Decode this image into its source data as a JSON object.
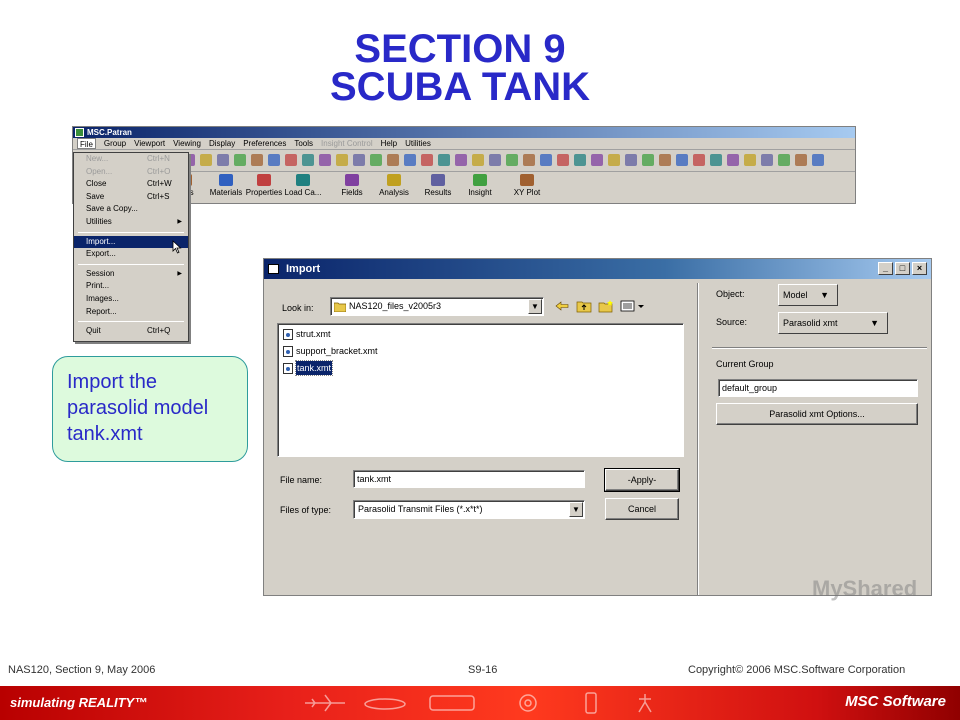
{
  "slide": {
    "title_line1": "SECTION 9",
    "title_line2": "SCUBA TANK",
    "callout": "Import the parasolid model tank.xmt",
    "footer_left": "NAS120, Section 9, May 2006",
    "footer_center": "S9-16",
    "footer_right": "Copyright© 2006 MSC.Software Corporation",
    "brand_left": "simulating REALITY™",
    "brand_right": "MSC Software",
    "watermark": "MyShared"
  },
  "patran": {
    "title": "MSC.Patran",
    "menu": [
      {
        "label": "File",
        "state": "active"
      },
      {
        "label": "Group",
        "state": "normal"
      },
      {
        "label": "Viewport",
        "state": "normal"
      },
      {
        "label": "Viewing",
        "state": "normal"
      },
      {
        "label": "Display",
        "state": "normal"
      },
      {
        "label": "Preferences",
        "state": "normal"
      },
      {
        "label": "Tools",
        "state": "normal"
      },
      {
        "label": "Insight Control",
        "state": "disabled"
      },
      {
        "label": "Help",
        "state": "normal"
      },
      {
        "label": "Utilities",
        "state": "normal"
      }
    ],
    "apps": [
      "/BCs",
      "Materials",
      "Properties",
      "Load Ca...",
      "Fields",
      "Analysis",
      "Results",
      "Insight",
      "XY Plot"
    ],
    "file_menu": [
      {
        "label": "New...",
        "shortcut": "Ctrl+N",
        "state": "disabled"
      },
      {
        "label": "Open...",
        "shortcut": "Ctrl+O",
        "state": "disabled"
      },
      {
        "label": "Close",
        "shortcut": "Ctrl+W",
        "state": "normal"
      },
      {
        "label": "Save",
        "shortcut": "Ctrl+S",
        "state": "normal"
      },
      {
        "label": "Save a Copy...",
        "shortcut": "",
        "state": "normal"
      },
      {
        "label": "Utilities",
        "shortcut": "",
        "state": "submenu"
      },
      {
        "sep": true
      },
      {
        "label": "Import...",
        "shortcut": "",
        "state": "selected"
      },
      {
        "label": "Export...",
        "shortcut": "",
        "state": "normal"
      },
      {
        "sep": true
      },
      {
        "label": "Session",
        "shortcut": "",
        "state": "submenu"
      },
      {
        "label": "Print...",
        "shortcut": "",
        "state": "normal"
      },
      {
        "label": "Images...",
        "shortcut": "",
        "state": "normal"
      },
      {
        "label": "Report...",
        "shortcut": "",
        "state": "normal"
      },
      {
        "sep": true
      },
      {
        "label": "Quit",
        "shortcut": "Ctrl+Q",
        "state": "normal"
      }
    ]
  },
  "import_dialog": {
    "title": "Import",
    "look_in_label": "Look in:",
    "look_in_value": "NAS120_files_v2005r3",
    "files": [
      {
        "name": "strut.xmt",
        "selected": false
      },
      {
        "name": "support_bracket.xmt",
        "selected": false
      },
      {
        "name": "tank.xmt",
        "selected": true
      }
    ],
    "file_name_label": "File name:",
    "file_name_value": "tank.xmt",
    "files_of_type_label": "Files of type:",
    "files_of_type_value": "Parasolid Transmit Files (*.x*t*)",
    "apply_label": "-Apply-",
    "cancel_label": "Cancel",
    "object_label": "Object:",
    "object_value": "Model",
    "source_label": "Source:",
    "source_value": "Parasolid xmt",
    "current_group_label": "Current Group",
    "current_group_value": "default_group",
    "options_label": "Parasolid xmt Options..."
  },
  "colors": {
    "title_blue": "#2929c8",
    "win_title": "#0a246a",
    "callout_fill": "#ddfadd",
    "brand_red": "#e8201a"
  }
}
